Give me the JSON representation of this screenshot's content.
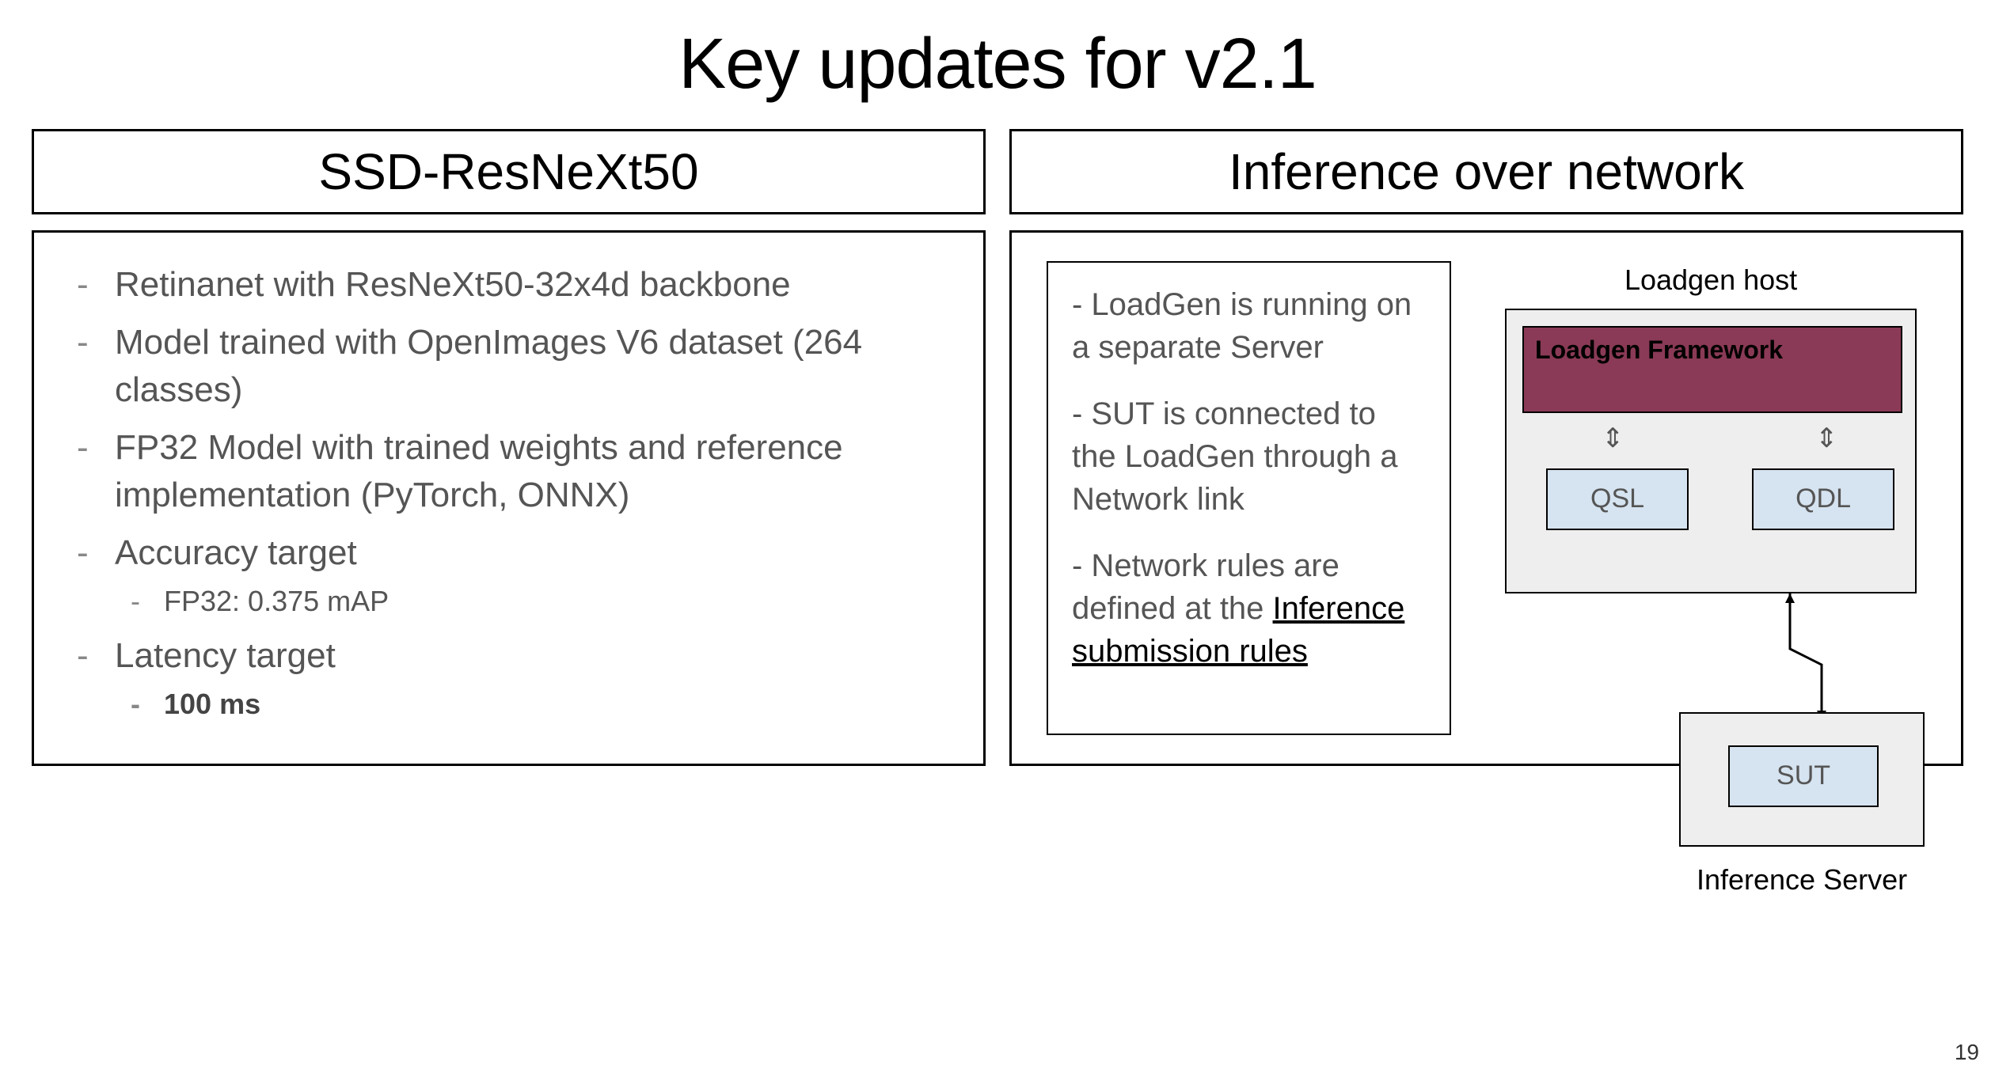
{
  "title": "Key updates for v2.1",
  "page_number": "19",
  "left": {
    "header": "SSD-ResNeXt50",
    "items": [
      "Retinanet with ResNeXt50-32x4d backbone",
      "Model trained with OpenImages V6 dataset (264 classes)",
      "FP32 Model with trained weights and reference implementation (PyTorch, ONNX)",
      "Accuracy target",
      "Latency target"
    ],
    "accuracy_sub": "FP32: 0.375 mAP",
    "latency_sub": "100 ms"
  },
  "right": {
    "header": "Inference over network",
    "para1": "- LoadGen is running on a separate Server",
    "para2": "- SUT is connected to the LoadGen through a Network link",
    "para3_prefix": "- Network rules are defined at the ",
    "para3_link": "Inference submission rules",
    "diagram": {
      "host_label": "Loadgen host",
      "framework": "Loadgen Framework",
      "qsl": "QSL",
      "qdl": "QDL",
      "sut": "SUT",
      "server_label": "Inference Server"
    }
  }
}
